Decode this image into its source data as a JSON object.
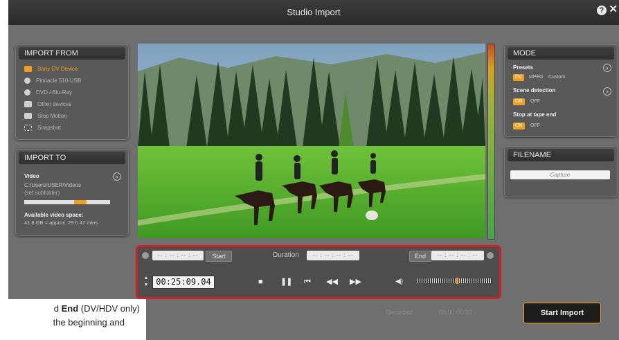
{
  "window": {
    "title": "Studio Import",
    "help": "?",
    "close": "✕"
  },
  "import_from": {
    "header": "IMPORT FROM",
    "items": [
      {
        "label": "Sony DV Device",
        "icon": "camcorder-icon",
        "active": true
      },
      {
        "label": "Pinnacle 510-USB",
        "icon": "chip-icon",
        "active": false
      },
      {
        "label": "DVD / Blu-Ray",
        "icon": "disc-icon",
        "active": false
      },
      {
        "label": "Other devices",
        "icon": "folder-icon",
        "active": false
      },
      {
        "label": "Stop Motion",
        "icon": "stopmotion-icon",
        "active": false
      },
      {
        "label": "Snapshot",
        "icon": "snapshot-icon",
        "active": false
      }
    ]
  },
  "import_to": {
    "header": "IMPORT TO",
    "video_label": "Video",
    "path": "C:\\Users\\USER\\Videos",
    "subfolder": "(set subfolder)",
    "space_label": "Available video space:",
    "space_value": "41.8 GB = approx. 29 h 47 mins",
    "space_fraction": 0.35
  },
  "mode": {
    "header": "MODE",
    "presets_label": "Presets",
    "presets_options": [
      "DV",
      "MPEG",
      "Custom"
    ],
    "scene_label": "Scene detection",
    "scene_options": [
      "ON",
      "OFF"
    ],
    "stop_label": "Stop at tape end",
    "stop_options": [
      "ON",
      "OFF"
    ]
  },
  "filename": {
    "header": "FILENAME",
    "value": "Capture"
  },
  "controls": {
    "start_time": "-- : -- : -- : --",
    "start_button": "Start",
    "duration_label": "Duration",
    "duration_value": "-- : -- : -- : --",
    "end_button": "End",
    "end_time": "-- : -- : -- : --",
    "timecode": "00:25:09.04"
  },
  "footer": {
    "recorded_label": "Recorded",
    "recorded_value": "00:00:00.00",
    "start_import": "Start Import"
  },
  "caption": {
    "line1_pre": "d ",
    "line1_bold": "End",
    "line1_post": " (DV/HDV only)",
    "line2": "the beginning and"
  },
  "colors": {
    "accent": "#f0a020",
    "highlight": "#cf2128"
  }
}
